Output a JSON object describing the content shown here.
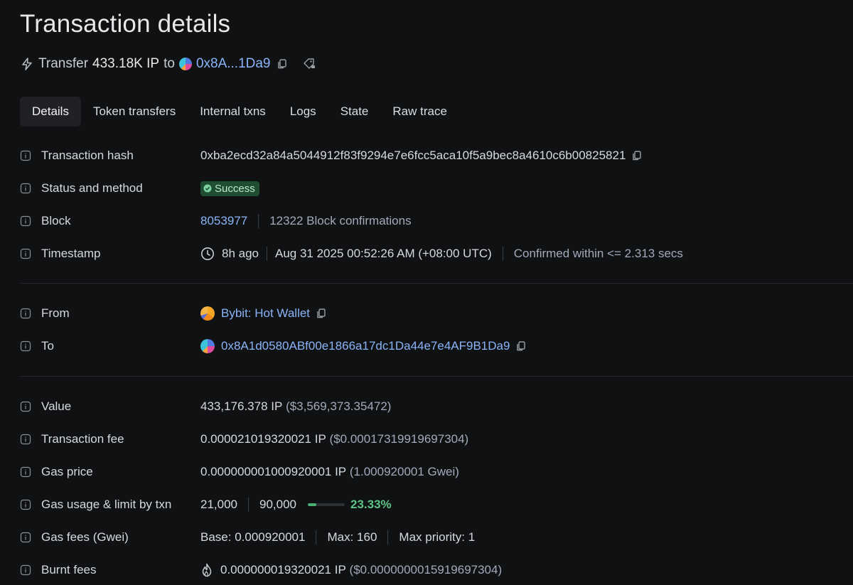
{
  "page": {
    "title": "Transaction details"
  },
  "summary": {
    "action": "Transfer",
    "amount": "433.18K IP",
    "to_word": "to",
    "to_short": "0x8A...1Da9"
  },
  "tabs": [
    {
      "label": "Details",
      "active": true
    },
    {
      "label": "Token transfers"
    },
    {
      "label": "Internal txns"
    },
    {
      "label": "Logs"
    },
    {
      "label": "State"
    },
    {
      "label": "Raw trace"
    }
  ],
  "rows": {
    "tx_hash": {
      "label": "Transaction hash",
      "value": "0xba2ecd32a84a5044912f83f9294e7e6fcc5aca10f5a9bec8a4610c6b00825821"
    },
    "status": {
      "label": "Status and method",
      "value": "Success"
    },
    "block": {
      "label": "Block",
      "value": "8053977",
      "confirmations": "12322 Block confirmations"
    },
    "timestamp": {
      "label": "Timestamp",
      "ago": "8h ago",
      "datetime": "Aug 31 2025 00:52:26 AM (+08:00 UTC)",
      "confirmed": "Confirmed within <= 2.313 secs"
    },
    "from": {
      "label": "From",
      "value": "Bybit: Hot Wallet"
    },
    "to": {
      "label": "To",
      "value": "0x8A1d0580ABf00e1866a17dc1Da44e7e4AF9B1Da9"
    },
    "value": {
      "label": "Value",
      "amount": "433,176.378 IP",
      "usd": "($3,569,373.35472)"
    },
    "fee": {
      "label": "Transaction fee",
      "amount": "0.000021019320021 IP",
      "usd": "($0.00017319919697304)"
    },
    "gas_price": {
      "label": "Gas price",
      "amount": "0.000000001000920001 IP",
      "gwei": "(1.000920001 Gwei)"
    },
    "gas_usage": {
      "label": "Gas usage & limit by txn",
      "used": "21,000",
      "limit": "90,000",
      "percent": "23.33%",
      "fraction": 0.2333
    },
    "gas_fees": {
      "label": "Gas fees (Gwei)",
      "base": "Base: 0.000920001",
      "max": "Max: 160",
      "priority": "Max priority: 1"
    },
    "burnt": {
      "label": "Burnt fees",
      "amount": "0.000000019320021 IP",
      "usd": "($0.0000000015919697304)"
    }
  },
  "colors": {
    "accent_link": "#8ab4f8",
    "success": "#5cc486",
    "background": "#101112"
  },
  "icons": [
    "bolt-icon",
    "copy-icon",
    "tag-icon",
    "info-icon",
    "check-circle-icon",
    "clock-icon",
    "flame-icon"
  ]
}
